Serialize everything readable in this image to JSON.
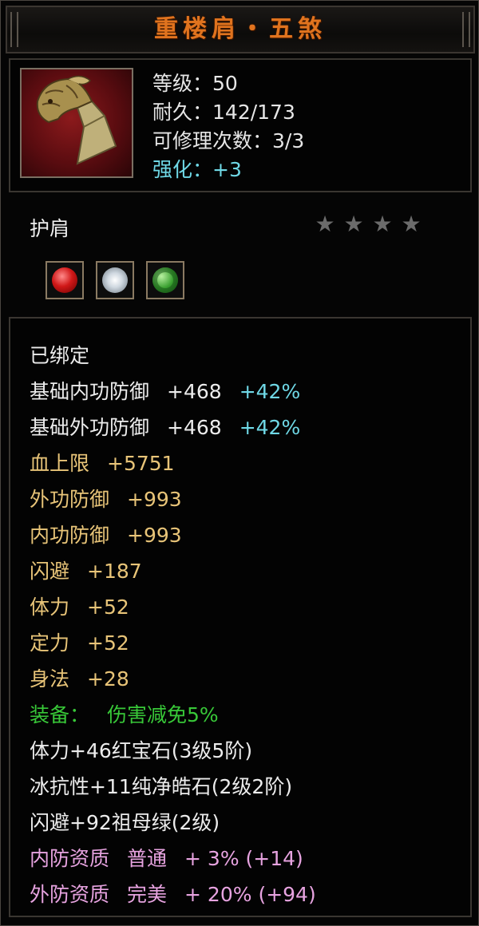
{
  "title": "重楼肩・五煞",
  "item": {
    "icon": "shoulder-armor-icon",
    "level": {
      "label": "等级：",
      "value": "50"
    },
    "durability": {
      "label": "耐久：",
      "value": "142/173"
    },
    "repairs": {
      "label": "可修理次数：",
      "value": "3/3"
    },
    "enhance": {
      "label": "强化：",
      "value": "+3"
    },
    "type": "护肩",
    "stars": {
      "total": 4,
      "filled": 0
    }
  },
  "sockets": [
    {
      "icon": "ruby-gem-icon"
    },
    {
      "icon": "diamond-gem-icon"
    },
    {
      "icon": "emerald-gem-icon"
    }
  ],
  "attributes": {
    "bound": "已绑定",
    "base_inner_def": {
      "label": "基础内功防御",
      "value": "+468",
      "bonus": "+42%"
    },
    "base_outer_def": {
      "label": "基础外功防御",
      "value": "+468",
      "bonus": "+42%"
    },
    "hp_max": {
      "label": "血上限",
      "value": "+5751"
    },
    "outer_def": {
      "label": "外功防御",
      "value": "+993"
    },
    "inner_def": {
      "label": "内功防御",
      "value": "+993"
    },
    "dodge": {
      "label": "闪避",
      "value": "+187"
    },
    "stamina": {
      "label": "体力",
      "value": "+52"
    },
    "focus": {
      "label": "定力",
      "value": "+52"
    },
    "agility": {
      "label": "身法",
      "value": "+28"
    },
    "equip_effect": {
      "label": "装备：",
      "value": "伤害减免5%"
    },
    "gem1": "体力+46红宝石(3级5阶)",
    "gem2": "冰抗性+11纯净皓石(2级2阶)",
    "gem3": "闪避+92祖母绿(2级)",
    "inner_quality": {
      "label": "内防资质",
      "grade": "普通",
      "value": "+ 3% (+14)"
    },
    "outer_quality": {
      "label": "外防资质",
      "grade": "完美",
      "value": "+ 20% (+94)"
    }
  },
  "colors": {
    "title": "#e0731e",
    "enhance": "#6fd8e6",
    "gold": "#e8c478",
    "green": "#38c838",
    "pink": "#e7a3e0"
  }
}
